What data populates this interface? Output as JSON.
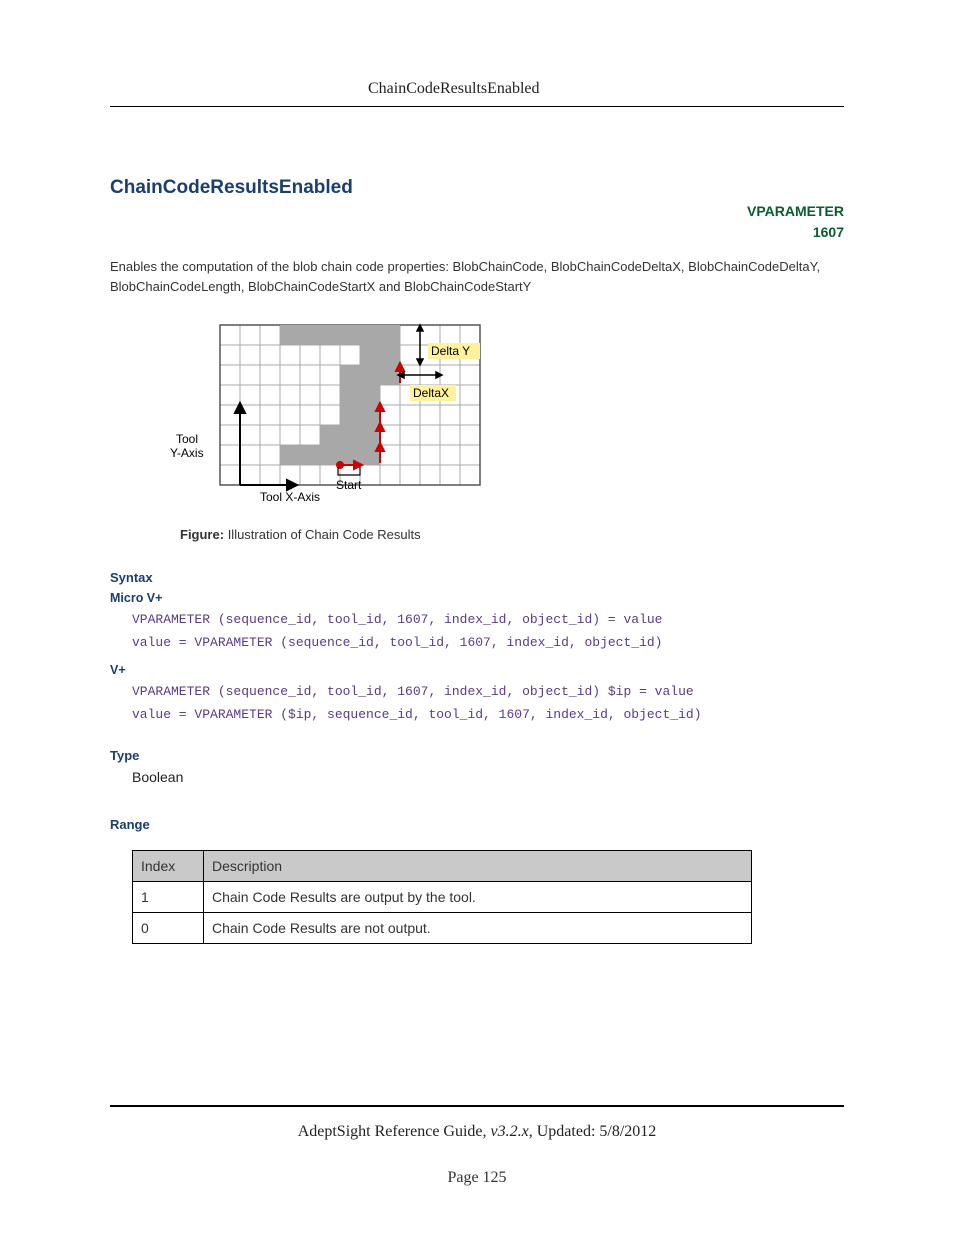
{
  "header": {
    "title": "ChainCodeResultsEnabled"
  },
  "title": "ChainCodeResultsEnabled",
  "vparam": {
    "label": "VPARAMETER",
    "number": "1607"
  },
  "intro": "Enables the computation of the blob chain code properties: BlobChainCode, BlobChainCodeDeltaX, BlobChainCodeDeltaY, BlobChainCodeLength, BlobChainCodeStartX and BlobChainCodeStartY",
  "figure": {
    "caption_label": "Figure:",
    "caption_text": "Illustration of Chain Code Results",
    "labels": {
      "deltaY": "Delta Y",
      "deltaX": "DeltaX",
      "toolY": "Tool\nY-Axis",
      "toolX": "Tool X-Axis",
      "start": "Start"
    }
  },
  "syntax": {
    "heading": "Syntax",
    "micro": {
      "heading": "Micro V+",
      "code": "VPARAMETER (sequence_id, tool_id, 1607, index_id, object_id) = value\nvalue = VPARAMETER (sequence_id, tool_id, 1607, index_id, object_id)"
    },
    "vplus": {
      "heading": "V+",
      "code": "VPARAMETER (sequence_id, tool_id, 1607, index_id, object_id) $ip = value\nvalue = VPARAMETER ($ip, sequence_id, tool_id, 1607, index_id, object_id)"
    }
  },
  "type": {
    "heading": "Type",
    "value": "Boolean"
  },
  "range": {
    "heading": "Range",
    "headers": {
      "index": "Index",
      "desc": "Description"
    },
    "rows": [
      {
        "index": "1",
        "desc": "Chain Code Results are output by the tool."
      },
      {
        "index": "0",
        "desc": "Chain Code Results are not output."
      }
    ]
  },
  "footer": {
    "guide": "AdeptSight Reference Guide",
    "version": ", v3.2.x",
    "updated": ", Updated: 5/8/2012",
    "page": "Page 125"
  }
}
